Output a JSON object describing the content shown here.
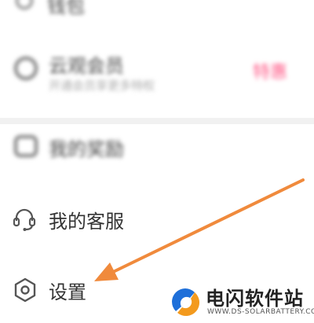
{
  "menu": {
    "row_top_label": "钱包",
    "row_two_label": "云观会员",
    "row_two_sub": "开通会员享更多特权",
    "row_two_promo": "特惠",
    "row_three_label": "我的奖励",
    "customer_service_label": "我的客服",
    "settings_label": "设置"
  },
  "watermark": {
    "title": "电闪软件站",
    "subtitle": "WWW.DS-SOLARBATTERY.COM"
  },
  "colors": {
    "arrow": "#f08a3c",
    "promo": "#ff5e8a",
    "logo_blue": "#1e6fd9",
    "logo_orange": "#f39a1e"
  }
}
